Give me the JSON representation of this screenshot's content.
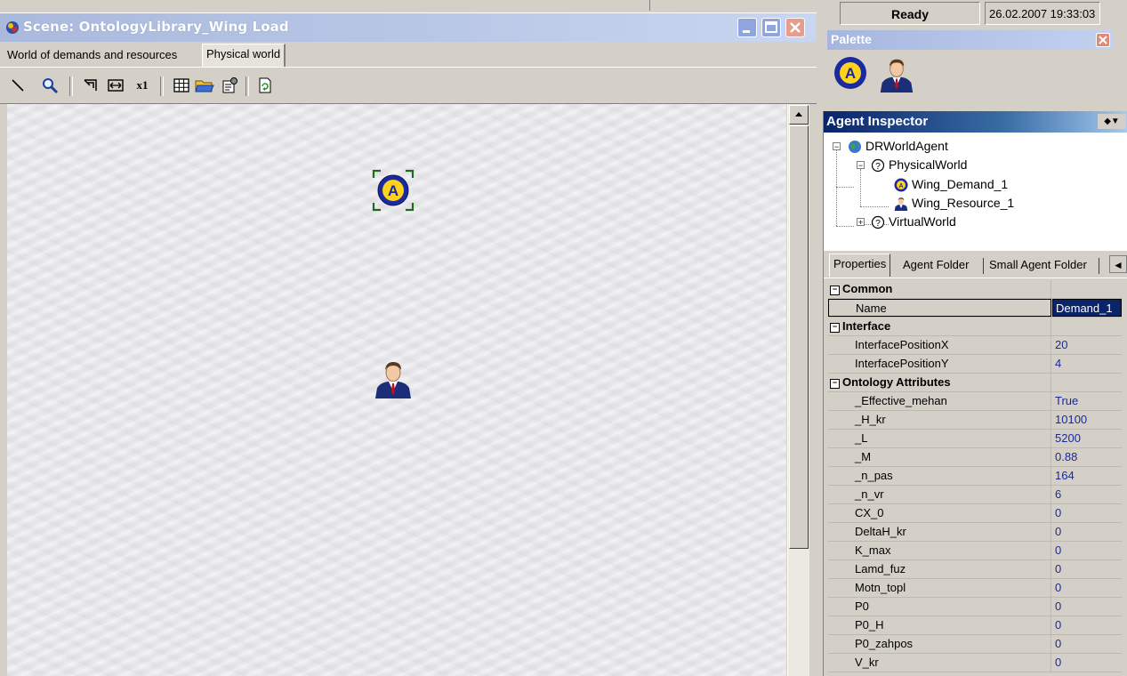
{
  "scene": {
    "title": "Scene: OntologyLibrary_Wing Load",
    "tabs": [
      "World of demands and resources",
      "Physical world"
    ],
    "active_tab": "Physical world",
    "toolbar_icons": [
      "line-tool-icon",
      "zoom-icon",
      "fit-icon",
      "fit-width-icon",
      "scale-1x-icon",
      "grid-icon",
      "open-folder-icon",
      "properties-icon",
      "refresh-icon"
    ],
    "zoom_label": "x1"
  },
  "status": {
    "state": "Ready",
    "datetime": "26.02.2007 19:33:03"
  },
  "palette": {
    "title": "Palette",
    "items": [
      "demand-agent-icon",
      "resource-agent-icon"
    ]
  },
  "inspector": {
    "title": "Agent Inspector",
    "menu_glyph": "◆▼",
    "tree": [
      {
        "label": "DRWorldAgent",
        "icon": "globe-icon",
        "level": 0,
        "expander": "−"
      },
      {
        "label": "PhysicalWorld",
        "icon": "question-icon",
        "level": 1,
        "expander": "−"
      },
      {
        "label": "Wing_Demand_1",
        "icon": "demand-agent-icon",
        "level": 2
      },
      {
        "label": "Wing_Resource_1",
        "icon": "resource-agent-icon",
        "level": 2
      },
      {
        "label": "VirtualWorld",
        "icon": "question-icon",
        "level": 1,
        "expander": "+"
      }
    ],
    "prop_tabs": [
      "Properties",
      "Agent Folder",
      "Small Agent Folder"
    ],
    "tab_scroll_glyph": "◄",
    "grid": [
      {
        "type": "cat",
        "label": "Common"
      },
      {
        "type": "item",
        "label": "Name",
        "value": "Demand_1",
        "selected": true
      },
      {
        "type": "cat",
        "label": "Interface"
      },
      {
        "type": "item",
        "label": "InterfacePositionX",
        "value": "20"
      },
      {
        "type": "item",
        "label": "InterfacePositionY",
        "value": "4"
      },
      {
        "type": "cat",
        "label": "Ontology Attributes"
      },
      {
        "type": "item",
        "label": "_Effective_mehan",
        "value": "True"
      },
      {
        "type": "item",
        "label": "_H_kr",
        "value": "10100"
      },
      {
        "type": "item",
        "label": "_L",
        "value": "5200"
      },
      {
        "type": "item",
        "label": "_M",
        "value": "0.88"
      },
      {
        "type": "item",
        "label": "_n_pas",
        "value": "164"
      },
      {
        "type": "item",
        "label": "_n_vr",
        "value": "6"
      },
      {
        "type": "item",
        "label": "CX_0",
        "value": "0"
      },
      {
        "type": "item",
        "label": "DeltaH_kr",
        "value": "0"
      },
      {
        "type": "item",
        "label": "K_max",
        "value": "0"
      },
      {
        "type": "item",
        "label": "Lamd_fuz",
        "value": "0"
      },
      {
        "type": "item",
        "label": "Motn_topl",
        "value": "0"
      },
      {
        "type": "item",
        "label": "P0",
        "value": "0"
      },
      {
        "type": "item",
        "label": "P0_H",
        "value": "0"
      },
      {
        "type": "item",
        "label": "P0_zahpos",
        "value": "0"
      },
      {
        "type": "item",
        "label": "V_kr",
        "value": "0"
      }
    ],
    "cat_box_glyph": "−"
  },
  "colors": {
    "title_inactive": "#b8c6e6",
    "inspector_title": "#0a246a",
    "value_text": "#1a2a9a"
  }
}
